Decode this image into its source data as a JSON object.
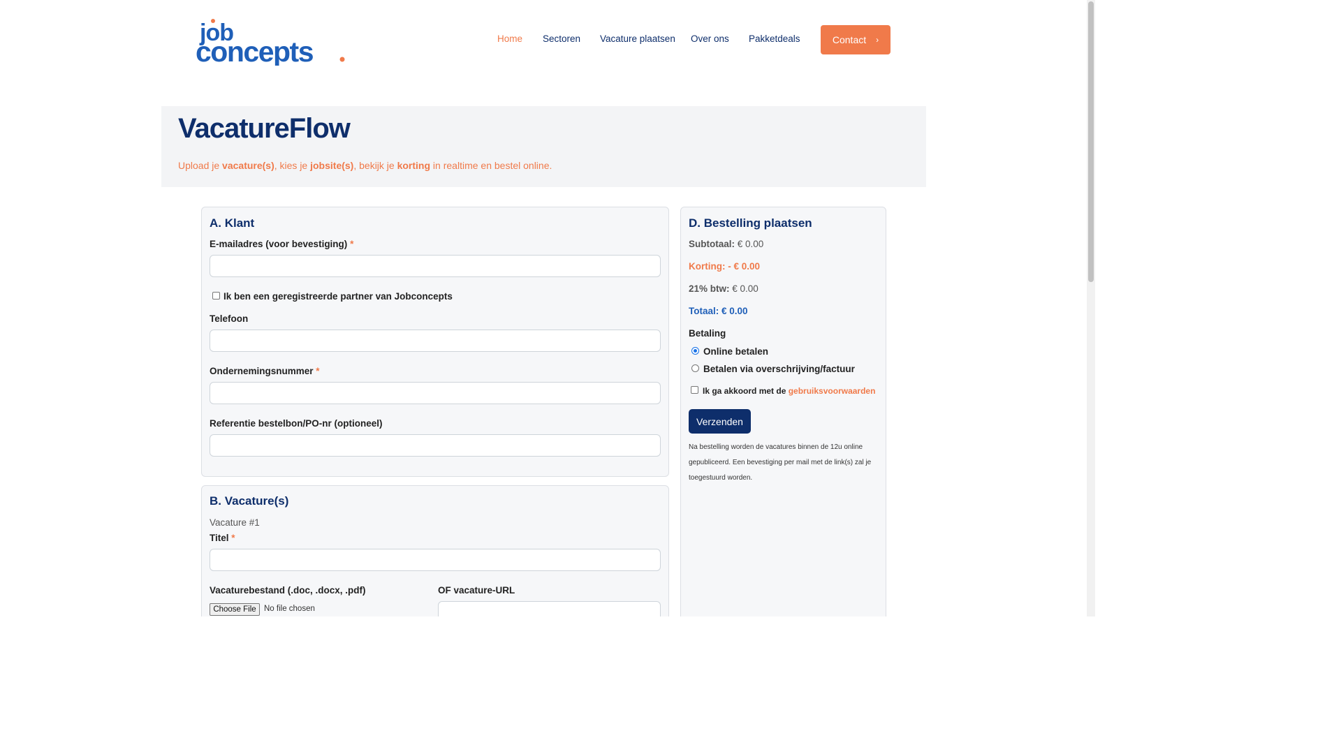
{
  "logo": {
    "line1": "job",
    "line2": "concepts",
    "color_blue": "#1f5fb8",
    "color_orange": "#f07a4a"
  },
  "nav": {
    "items": [
      {
        "label": "Home",
        "active": true
      },
      {
        "label": "Sectoren"
      },
      {
        "label": "Vacature plaatsen"
      },
      {
        "label": "Over ons"
      },
      {
        "label": "Pakketdeals"
      }
    ],
    "contact_label": "Contact",
    "contact_icon": "chevron-right-icon"
  },
  "hero": {
    "title": "VacatureFlow",
    "sub_1": "Upload je ",
    "sub_b1": "vacature(s)",
    "sub_2": ", kies je ",
    "sub_b2": "jobsite(s)",
    "sub_3": ", bekijk je ",
    "sub_b3": "korting",
    "sub_4": " in realtime en bestel online."
  },
  "klant": {
    "title": "A. Klant",
    "email_label": "E-mailadres (voor bevestiging)",
    "email_value": "",
    "partner_label": "Ik ben een geregistreerde partner van Jobconcepts",
    "partner_checked": false,
    "telefoon_label": "Telefoon",
    "telefoon_value": "",
    "onderneming_label": "Ondernemingsnummer",
    "onderneming_value": "",
    "referentie_label": "Referentie bestelbon/PO-nr (optioneel)",
    "referentie_value": "",
    "required_mark": "*"
  },
  "vacatures": {
    "title": "B. Vacature(s)",
    "item_label": "Vacature #1",
    "titel_label": "Titel",
    "titel_value": "",
    "bestand_label": "Vacaturebestand (.doc, .docx, .pdf)",
    "file_button": "Choose File",
    "file_status": "No file chosen",
    "url_label": "OF vacature-URL",
    "url_value": ""
  },
  "bestelling": {
    "title": "D. Bestelling plaatsen",
    "subtotaal_label": "Subtotaal:",
    "subtotaal_value": "€ 0.00",
    "korting_label": "Korting:",
    "korting_value": "- € 0.00",
    "btw_label": "21% btw:",
    "btw_value": "€ 0.00",
    "totaal_label": "Totaal:",
    "totaal_value": "€ 0.00",
    "betaling_label": "Betaling",
    "betaling_options": [
      {
        "label": "Online betalen",
        "selected": true
      },
      {
        "label": "Betalen via overschrijving/factuur",
        "selected": false
      }
    ],
    "akkoord_text": "Ik ga akkoord met de ",
    "akkoord_link": "gebruiksvoorwaarden",
    "submit_label": "Verzenden",
    "note": "Na bestelling worden de vacatures binnen de 12u online gepubliceerd. Een bevestiging per mail met de link(s) zal je toegestuurd worden."
  }
}
